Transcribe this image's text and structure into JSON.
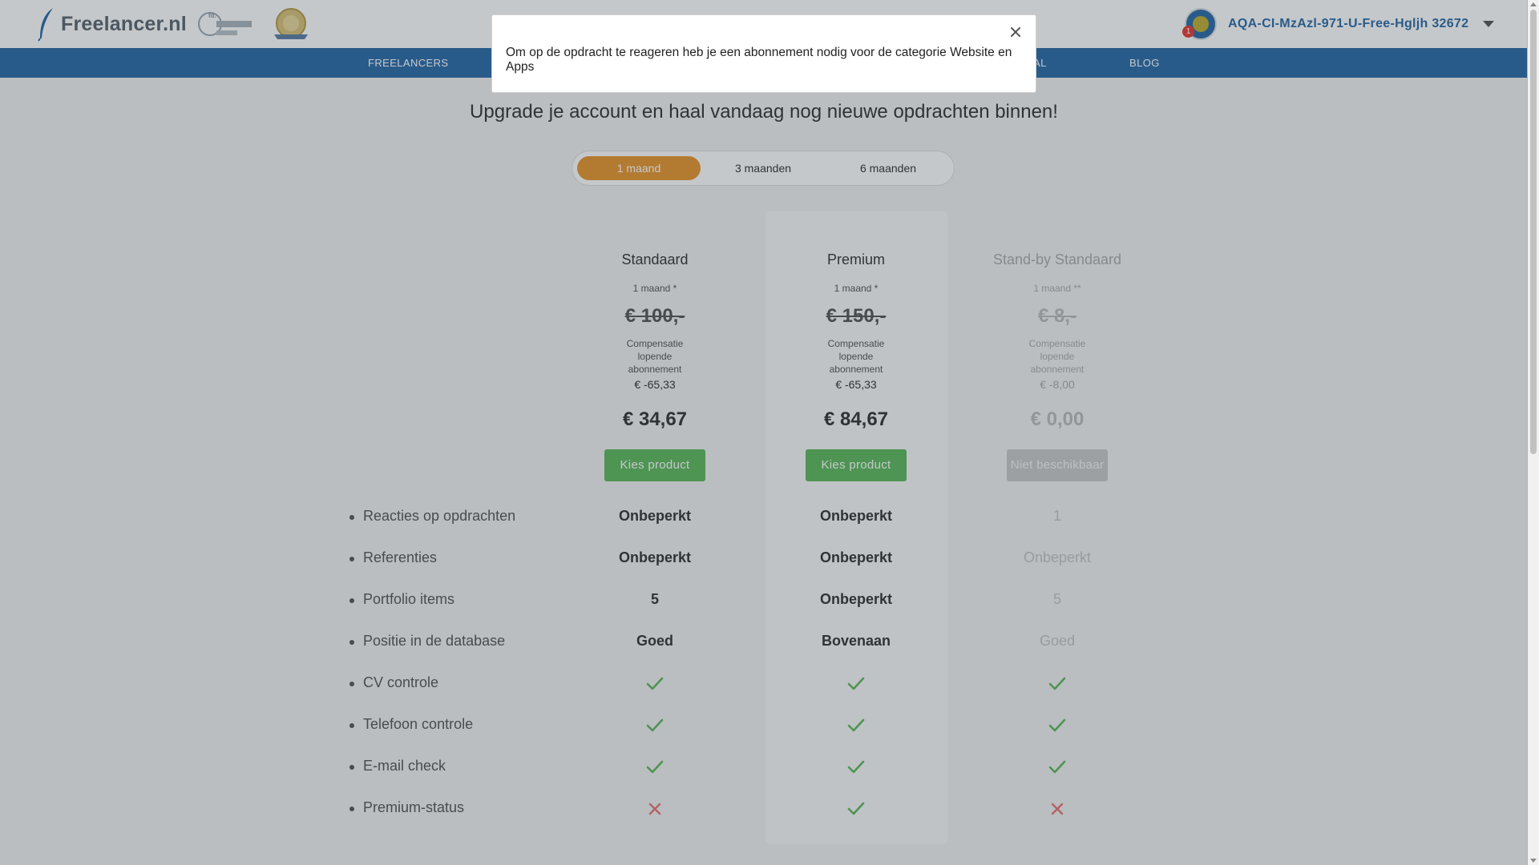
{
  "header": {
    "logo_text": "Freelancer.nl",
    "user_name": "AQA-CI-MzAzl-971-U-Free-Hgljh 32672",
    "notification_count": "1"
  },
  "nav": {
    "items": [
      "FREELANCERS",
      "IAL",
      "BLOG"
    ]
  },
  "headline": "Upgrade je account en haal vandaag nog nieuwe opdrachten binnen!",
  "period_toggle": {
    "options": [
      "1 maand",
      "3 maanden",
      "6 maanden"
    ],
    "selected": "1 maand"
  },
  "plans": [
    {
      "name": "Standaard",
      "duration": "1 maand *",
      "old_price": "€ 100,-",
      "compensation_label": "Compensatie lopende abonnement",
      "compensation_value": "€ -65,33",
      "price": "€ 34,67",
      "button_label": "Kies product",
      "available": true
    },
    {
      "name": "Premium",
      "duration": "1 maand *",
      "old_price": "€ 150,-",
      "compensation_label": "Compensatie lopende abonnement",
      "compensation_value": "€ -65,33",
      "price": "€ 84,67",
      "button_label": "Kies product",
      "available": true
    },
    {
      "name": "Stand-by Standaard",
      "duration": "1 maand **",
      "old_price": "€ 8,-",
      "compensation_label": "Compensatie lopende abonnement",
      "compensation_value": "€ -8,00",
      "price": "€ 0,00",
      "button_label": "Niet beschikbaar",
      "available": false
    }
  ],
  "features": [
    {
      "label": "Reacties op opdrachten",
      "values": [
        "Onbeperkt",
        "Onbeperkt",
        "1"
      ]
    },
    {
      "label": "Referenties",
      "values": [
        "Onbeperkt",
        "Onbeperkt",
        "Onbeperkt"
      ]
    },
    {
      "label": "Portfolio items",
      "values": [
        "5",
        "Onbeperkt",
        "5"
      ]
    },
    {
      "label": "Positie in de database",
      "values": [
        "Goed",
        "Bovenaan",
        "Goed"
      ]
    },
    {
      "label": "CV controle",
      "values": [
        "check",
        "check",
        "check"
      ]
    },
    {
      "label": "Telefoon controle",
      "values": [
        "check",
        "check",
        "check"
      ]
    },
    {
      "label": "E-mail check",
      "values": [
        "check",
        "check",
        "check"
      ]
    },
    {
      "label": "Premium-status",
      "values": [
        "cross",
        "check",
        "cross"
      ]
    }
  ],
  "modal": {
    "message": "Om op de opdracht te reageren heb je een abonnement nodig voor de categorie Website en Apps"
  },
  "colors": {
    "brand_blue": "#2a6aa8",
    "accent_orange": "#e6962e",
    "button_green": "#5cb85c",
    "check_green": "#5cb85c",
    "cross_red": "#e57373"
  }
}
